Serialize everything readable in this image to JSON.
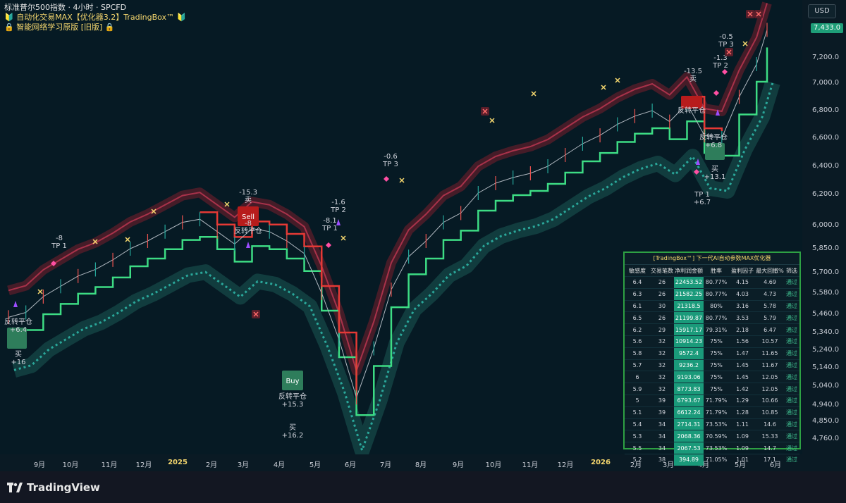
{
  "header": {
    "line1": "标准普尔500指数 · 4小时 · SPCFD",
    "line2": "🔰 自动化交易MAX【优化器3.2】TradingBox™ 🔰",
    "line3": "🔒 智能网络学习原版 [旧版] 🔒"
  },
  "currency": "USD",
  "last_price": "7,433.0",
  "footer": {
    "brand": "TradingView"
  },
  "chart_data": {
    "type": "line",
    "symbol": "SPCFD",
    "ylim": [
      4700,
      7600
    ],
    "y_ticks": [
      "7,200.0",
      "7,000.0",
      "6,800.0",
      "6,600.0",
      "6,400.0",
      "6,200.0",
      "6,000.0",
      "5,850.0",
      "5,700.0",
      "5,580.0",
      "5,460.0",
      "5,340.0",
      "5,240.0",
      "5,140.0",
      "5,040.0",
      "4,940.0",
      "4,850.0",
      "4,760.0"
    ],
    "x_ticks": [
      "9月",
      "10月",
      "11月",
      "12月",
      "2025",
      "2月",
      "3月",
      "4月",
      "5月",
      "6月",
      "7月",
      "8月",
      "9月",
      "10月",
      "11月",
      "12月",
      "2026",
      "2月",
      "3月",
      "4月",
      "5月",
      "6月"
    ],
    "year_ticks": [
      "2025",
      "2026"
    ],
    "x_index": [
      0,
      5,
      10,
      15,
      20,
      25,
      30,
      35,
      40,
      45,
      50,
      55,
      60,
      65,
      70,
      75,
      80,
      85,
      90,
      95,
      100,
      105,
      110,
      115,
      120,
      125,
      130,
      135,
      140,
      145,
      150,
      155,
      160,
      165,
      170,
      175,
      180,
      185,
      190,
      195,
      200,
      205,
      210,
      215,
      218
    ],
    "series": [
      {
        "name": "",
        "values": [
          5440,
          5470,
          5560,
          5620,
          5680,
          5720,
          5780,
          5850,
          5900,
          5960,
          6020,
          6040,
          5960,
          5880,
          5980,
          5960,
          5900,
          5820,
          5580,
          5300,
          4980,
          5250,
          5600,
          5800,
          5900,
          6020,
          6080,
          6210,
          6280,
          6320,
          6350,
          6400,
          6480,
          6560,
          6620,
          6700,
          6760,
          6800,
          6720,
          6850,
          6620,
          6600,
          6900,
          7150,
          7420
        ]
      }
    ],
    "markers": [
      {
        "label": "-8",
        "sub": "TP 1"
      },
      {
        "label": "-15.3",
        "sub": "卖"
      },
      {
        "label": "Sell"
      },
      {
        "label": "-8"
      },
      {
        "label": "反转平仓"
      },
      {
        "label": "-1.6",
        "sub": "TP 2"
      },
      {
        "label": "-8.1",
        "sub": "TP 1"
      },
      {
        "label": "-0.6",
        "sub": "TP 3"
      },
      {
        "label": "-13.5",
        "sub": "卖"
      },
      {
        "label": "反转平仓"
      },
      {
        "label": "-0.5",
        "sub": "TP 3"
      },
      {
        "label": "-1.3",
        "sub": "TP 2"
      },
      {
        "label": "Buy"
      },
      {
        "label": "反转平仓",
        "sub": "+15.3"
      },
      {
        "label": "买",
        "sub": "+16.2"
      },
      {
        "label": "反转平仓",
        "sub": "+6.4"
      },
      {
        "label": "买",
        "sub": "+16"
      },
      {
        "label": "反转平仓",
        "sub": "+6.8"
      },
      {
        "label": "买",
        "sub": "+13.1"
      },
      {
        "label": "TP 1",
        "sub": "+6.7"
      }
    ],
    "colors": {
      "upper_band": "#7a1f2c",
      "trail_green": "#3ddc84",
      "trail_red": "#e53935",
      "lower_band": "#1b5e57",
      "sell_box": "#b71c1c",
      "buy_box": "#2e7d5b",
      "marker_pink": "#ff4fa3",
      "marker_purple": "#9c4dff",
      "marker_yellow": "#f5d76e"
    }
  },
  "optimizer": {
    "title": "[TradingBox™] 下一代AI自动参数MAX优化器",
    "columns": [
      "敏感度",
      "交易笔数",
      "净利润金额",
      "胜率",
      "盈利因子",
      "最大回撤%",
      "筛选"
    ],
    "rows": [
      [
        "6.4",
        "26",
        "22453.52",
        "80.77%",
        "4.15",
        "4.69",
        "通过"
      ],
      [
        "6.3",
        "26",
        "21582.25",
        "80.77%",
        "4.03",
        "4.73",
        "通过"
      ],
      [
        "6.1",
        "30",
        "21318.5",
        "80%",
        "3.16",
        "5.78",
        "通过"
      ],
      [
        "6.5",
        "26",
        "21199.87",
        "80.77%",
        "3.53",
        "5.79",
        "通过"
      ],
      [
        "6.2",
        "29",
        "15917.17",
        "79.31%",
        "2.18",
        "6.47",
        "通过"
      ],
      [
        "5.6",
        "32",
        "10914.23",
        "75%",
        "1.56",
        "10.57",
        "通过"
      ],
      [
        "5.8",
        "32",
        "9572.4",
        "75%",
        "1.47",
        "11.65",
        "通过"
      ],
      [
        "5.7",
        "32",
        "9236.2",
        "75%",
        "1.45",
        "11.67",
        "通过"
      ],
      [
        "6",
        "32",
        "9193.06",
        "75%",
        "1.45",
        "12.05",
        "通过"
      ],
      [
        "5.9",
        "32",
        "8773.83",
        "75%",
        "1.42",
        "12.05",
        "通过"
      ],
      [
        "5",
        "39",
        "6793.67",
        "71.79%",
        "1.29",
        "10.66",
        "通过"
      ],
      [
        "5.1",
        "39",
        "6612.24",
        "71.79%",
        "1.28",
        "10.85",
        "通过"
      ],
      [
        "5.4",
        "34",
        "2714.31",
        "73.53%",
        "1.11",
        "14.6",
        "通过"
      ],
      [
        "5.3",
        "34",
        "2068.36",
        "70.59%",
        "1.09",
        "15.33",
        "通过"
      ],
      [
        "5.5",
        "34",
        "2067.53",
        "73.53%",
        "1.09",
        "14.7",
        "通过"
      ],
      [
        "5.2",
        "38",
        "394.89",
        "71.05%",
        "1.01",
        "17.1",
        "通过"
      ]
    ]
  }
}
